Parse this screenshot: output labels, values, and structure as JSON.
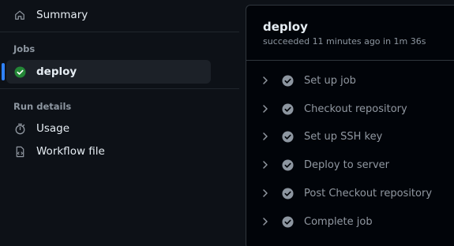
{
  "sidebar": {
    "summary_label": "Summary",
    "jobs_heading": "Jobs",
    "active_job": {
      "label": "deploy",
      "status": "success"
    },
    "run_details_heading": "Run details",
    "usage_label": "Usage",
    "workflow_file_label": "Workflow file"
  },
  "job": {
    "title": "deploy",
    "status_text": "succeeded 11 minutes ago in 1m 36s",
    "steps": [
      {
        "label": "Set up job"
      },
      {
        "label": "Checkout repository"
      },
      {
        "label": "Set up SSH key"
      },
      {
        "label": "Deploy to server"
      },
      {
        "label": "Post Checkout repository"
      },
      {
        "label": "Complete job"
      }
    ]
  },
  "colors": {
    "background": "#0d1117",
    "accent": "#2f81f7",
    "success": "#238636",
    "muted_text": "#8d96a0"
  }
}
